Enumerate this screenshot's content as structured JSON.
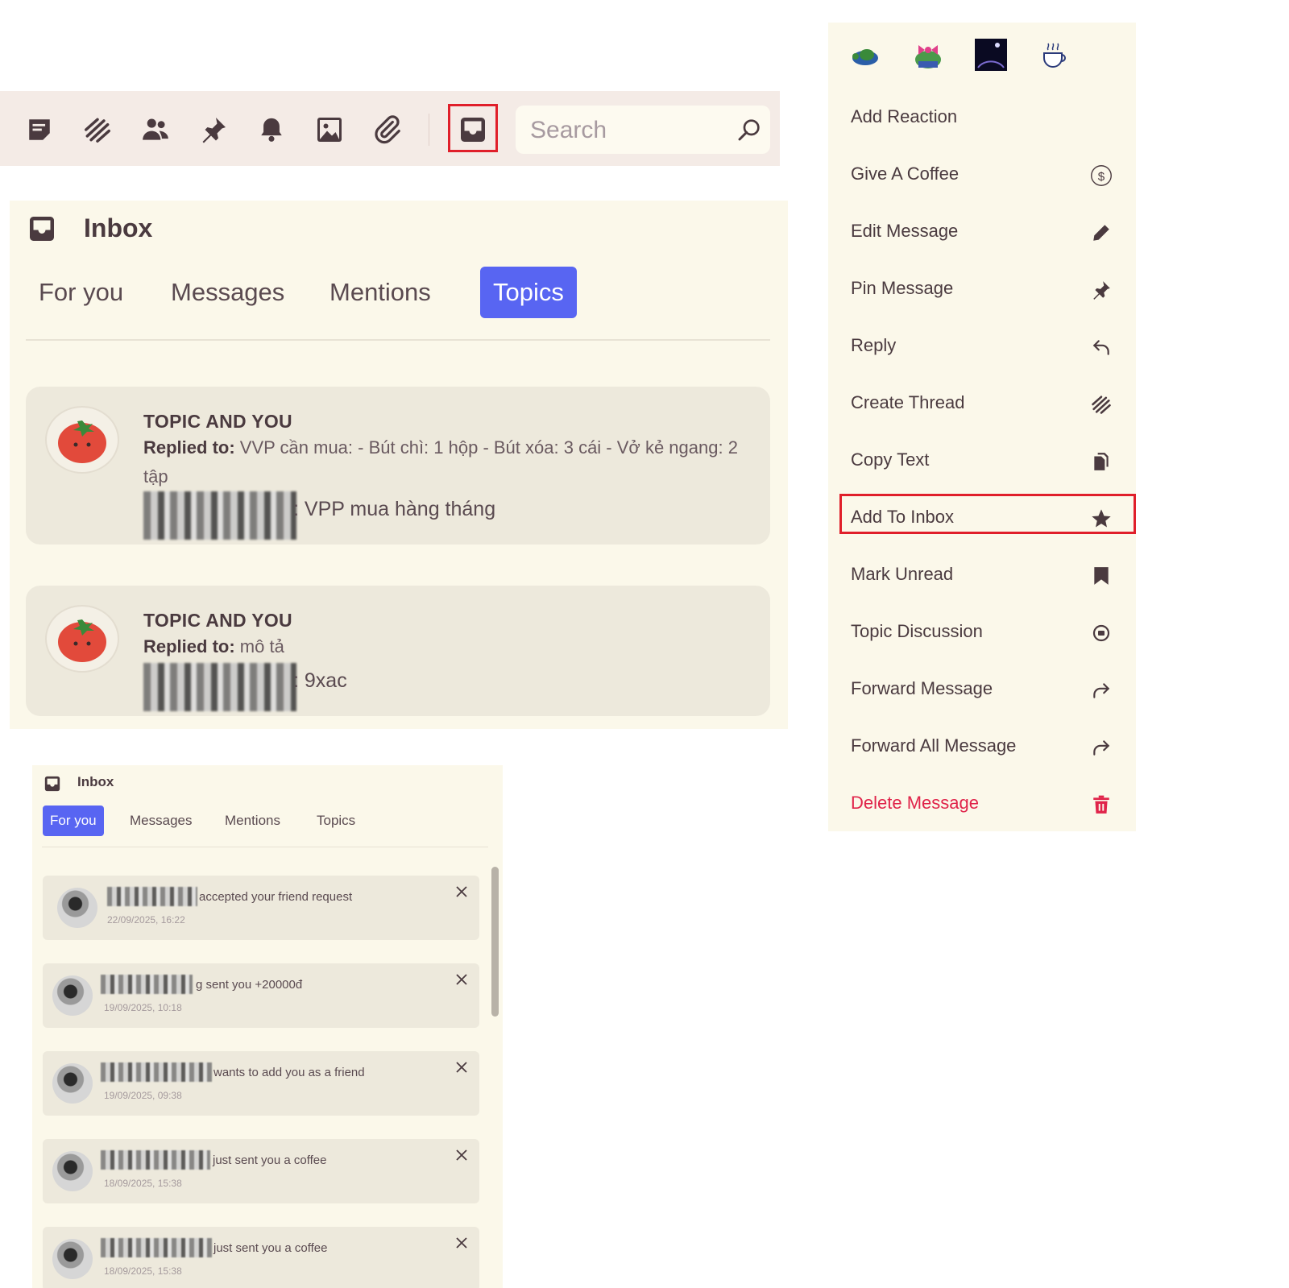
{
  "toolbar": {
    "icons": [
      "notes-icon",
      "threads-icon",
      "members-icon",
      "pin-icon",
      "bell-icon",
      "image-icon",
      "attachment-icon",
      "inbox-icon"
    ],
    "search": {
      "placeholder": "Search"
    }
  },
  "inbox_large": {
    "title": "Inbox",
    "tabs": [
      {
        "label": "For you",
        "active": false
      },
      {
        "label": "Messages",
        "active": false
      },
      {
        "label": "Mentions",
        "active": false
      },
      {
        "label": "Topics",
        "active": true
      }
    ],
    "topics": [
      {
        "title": "TOPIC AND YOU",
        "reply_prefix": "Replied to:",
        "reply_text": "VVP cần mua: - Bút chì: 1 hộp - Bút xóa: 3 cái - Vở kẻ ngang: 2 tập",
        "message": ": VPP mua hàng tháng"
      },
      {
        "title": "TOPIC AND YOU",
        "reply_prefix": "Replied to:",
        "reply_text": "mô tả",
        "message": ": 9xac"
      }
    ]
  },
  "menu": {
    "emojis": [
      "turtle-emoji",
      "frog-bow-emoji",
      "moon-night-emoji",
      "coffee-emoji"
    ],
    "items": [
      {
        "label": "Add Reaction",
        "icon": ""
      },
      {
        "label": "Give A Coffee",
        "icon": "dollar-icon"
      },
      {
        "label": "Edit Message",
        "icon": "pencil-icon"
      },
      {
        "label": "Pin Message",
        "icon": "pin-icon"
      },
      {
        "label": "Reply",
        "icon": "reply-icon"
      },
      {
        "label": "Create Thread",
        "icon": "thread-icon"
      },
      {
        "label": "Copy Text",
        "icon": "copy-icon"
      },
      {
        "label": "Add To Inbox",
        "icon": "star-icon"
      },
      {
        "label": "Mark Unread",
        "icon": "bookmark-icon"
      },
      {
        "label": "Topic Discussion",
        "icon": "topic-icon"
      },
      {
        "label": "Forward Message",
        "icon": "forward-icon"
      },
      {
        "label": "Forward All Message",
        "icon": "forward-all-icon"
      },
      {
        "label": "Delete Message",
        "icon": "trash-icon"
      }
    ],
    "colors": {
      "danger": "#e0244a",
      "highlight": "#e01f2a"
    }
  },
  "inbox_small": {
    "title": "Inbox",
    "tabs": [
      {
        "label": "For you",
        "active": true
      },
      {
        "label": "Messages",
        "active": false
      },
      {
        "label": "Mentions",
        "active": false
      },
      {
        "label": "Topics",
        "active": false
      }
    ],
    "notifications": [
      {
        "text": "accepted your friend request",
        "time": "22/09/2025, 16:22"
      },
      {
        "text": "g sent you +20000đ",
        "time": "19/09/2025, 10:18"
      },
      {
        "text": "wants to add you as a friend",
        "time": "19/09/2025, 09:38"
      },
      {
        "text": "just sent you a coffee",
        "time": "18/09/2025, 15:38"
      },
      {
        "text": "just sent you a coffee",
        "time": "18/09/2025, 15:38"
      }
    ]
  },
  "accent": "#5865f2"
}
